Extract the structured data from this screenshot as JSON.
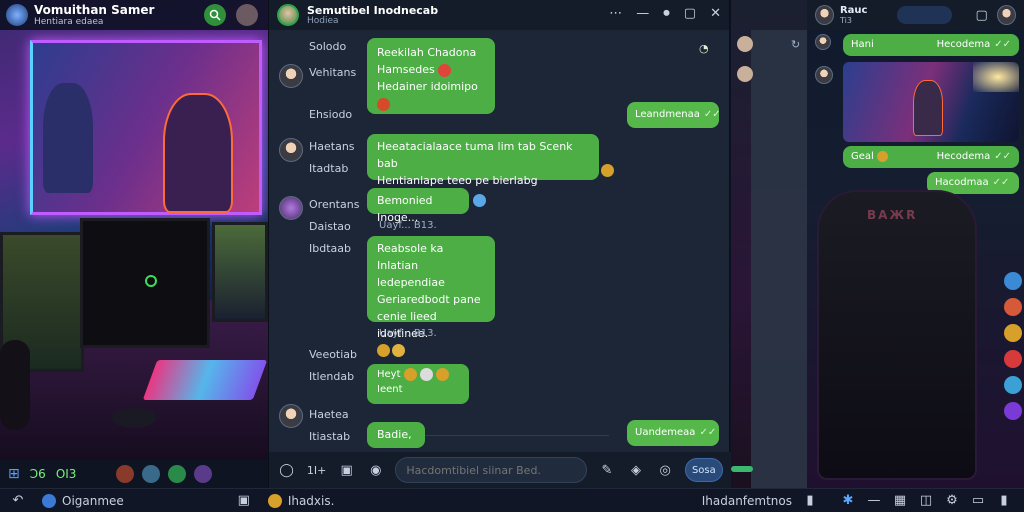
{
  "left_window": {
    "title": "Vomuithan Samer",
    "subtitle": "Hentiara edaea"
  },
  "left_taskbar": {
    "item1": "Ɔ6",
    "item2": "OI3"
  },
  "chat": {
    "header_title": "Semutibel Inodnecab",
    "header_subtitle": "Hodiea",
    "window_buttons": {
      "menu": "⋯",
      "minimize": "—",
      "toggle": "⏺",
      "restore": "▢",
      "close": "✕"
    },
    "messages": [
      {
        "time": "Solodo",
        "text_lines": [
          "Reekilah Chadona"
        ]
      },
      {
        "sender": "Vehitans",
        "text_lines": [
          "Hamsedes"
        ]
      },
      {
        "time": "Ehsiodo",
        "text_lines": [
          "Hedainer idoimipo"
        ]
      },
      {
        "outgoing_text": "Leandmenaa"
      },
      {
        "sender": "Haetans",
        "text_lines": [
          "Heeatacialaace tuma lim tab Scenk bab",
          "Hentianlape teeo pe bierlabg beledlabe."
        ]
      },
      {
        "time": "Itadtab"
      },
      {
        "sender": "Orentans",
        "text_lines": [
          "Bemonied Inoge..."
        ]
      },
      {
        "time": "Daistao"
      },
      {
        "meta1": "Uayf... B13."
      },
      {
        "time": "Ibdtaab",
        "text_lines": [
          "Reabsole ka",
          "Inlatian ledependiae",
          "Geriaredbodt pane",
          "cenie lieed idoitinee."
        ]
      },
      {
        "meta2": "Uayf... B13."
      },
      {
        "sender": "Veeotiab"
      },
      {
        "time": "Itlendab",
        "text_lines": [
          "Heyt",
          "Ieent"
        ]
      },
      {
        "sender": "Haetea"
      },
      {
        "time": "Itiastab",
        "text_lines": [
          "Badie,"
        ]
      },
      {
        "outgoing_text": "Uandemeaa"
      }
    ],
    "composer": {
      "counter": "1I+",
      "placeholder": "Hacdomtibiel siinar Bed.",
      "send_label": "Sosa"
    }
  },
  "right_chat": {
    "header_name": "Rauc",
    "header_sub": "Ti3",
    "messages": [
      {
        "text": "Hani",
        "right": "Hecodema"
      },
      {
        "text": "Geal",
        "right": "Hecodema"
      },
      {
        "text": "Hacodmaa"
      }
    ],
    "chair_label": "BAЖR"
  },
  "taskbar": {
    "app_label": "Oiganmee",
    "center_label": "Ihadxis.",
    "right_label": "Ihadanfemtnos"
  },
  "colors": {
    "bubble_green": "#4cae45",
    "accent_blue": "#2a4a7a",
    "chat_bg": "#1c2637"
  }
}
